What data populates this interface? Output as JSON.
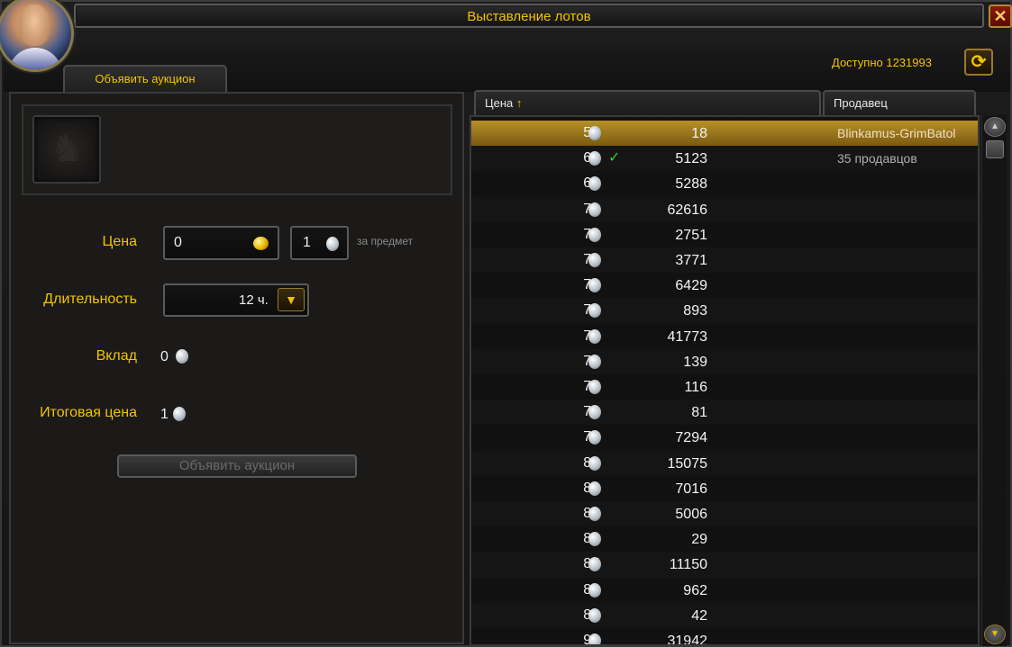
{
  "window": {
    "title": "Выставление лотов",
    "close_label": "✕"
  },
  "header": {
    "available": "Доступно 1231993",
    "refresh_label": "⟳"
  },
  "tab": {
    "label": "Объявить аукцион"
  },
  "form": {
    "price_label": "Цена",
    "price_gold": "0",
    "price_silver": "1",
    "per_item": "за предмет",
    "duration_label": "Длительность",
    "duration_value": "12 ч.",
    "deposit_label": "Вклад",
    "deposit_value": "0",
    "total_label": "Итоговая цена",
    "total_value": "1",
    "post_button": "Объявить аукцион"
  },
  "list": {
    "col_price": "Цена",
    "col_seller": "Продавец",
    "rows": [
      {
        "price": "55",
        "qty": "18",
        "seller": "Blinkamus-GrimBatol",
        "selected": true,
        "check": ""
      },
      {
        "price": "68",
        "qty": "5123",
        "seller": "35 продавцов",
        "selected": false,
        "check": "✓"
      },
      {
        "price": "69",
        "qty": "5288",
        "seller": "",
        "selected": false,
        "check": ""
      },
      {
        "price": "70",
        "qty": "62616",
        "seller": "",
        "selected": false,
        "check": ""
      },
      {
        "price": "71",
        "qty": "2751",
        "seller": "",
        "selected": false,
        "check": ""
      },
      {
        "price": "72",
        "qty": "3771",
        "seller": "",
        "selected": false,
        "check": ""
      },
      {
        "price": "73",
        "qty": "6429",
        "seller": "",
        "selected": false,
        "check": ""
      },
      {
        "price": "74",
        "qty": "893",
        "seller": "",
        "selected": false,
        "check": ""
      },
      {
        "price": "75",
        "qty": "41773",
        "seller": "",
        "selected": false,
        "check": ""
      },
      {
        "price": "76",
        "qty": "139",
        "seller": "",
        "selected": false,
        "check": ""
      },
      {
        "price": "77",
        "qty": "116",
        "seller": "",
        "selected": false,
        "check": ""
      },
      {
        "price": "78",
        "qty": "81",
        "seller": "",
        "selected": false,
        "check": ""
      },
      {
        "price": "79",
        "qty": "7294",
        "seller": "",
        "selected": false,
        "check": ""
      },
      {
        "price": "80",
        "qty": "15075",
        "seller": "",
        "selected": false,
        "check": ""
      },
      {
        "price": "81",
        "qty": "7016",
        "seller": "",
        "selected": false,
        "check": ""
      },
      {
        "price": "83",
        "qty": "5006",
        "seller": "",
        "selected": false,
        "check": ""
      },
      {
        "price": "85",
        "qty": "29",
        "seller": "",
        "selected": false,
        "check": ""
      },
      {
        "price": "87",
        "qty": "11150",
        "seller": "",
        "selected": false,
        "check": ""
      },
      {
        "price": "88",
        "qty": "962",
        "seller": "",
        "selected": false,
        "check": ""
      },
      {
        "price": "89",
        "qty": "42",
        "seller": "",
        "selected": false,
        "check": ""
      },
      {
        "price": "90",
        "qty": "31942",
        "seller": "",
        "selected": false,
        "check": ""
      }
    ]
  },
  "colors": {
    "accent": "#f2c400",
    "selected_row": "#b8902a"
  },
  "icons": {
    "silver_coin": "silver-coin-icon",
    "gold_coin": "gold-coin-icon",
    "item": "lion-head-icon"
  }
}
